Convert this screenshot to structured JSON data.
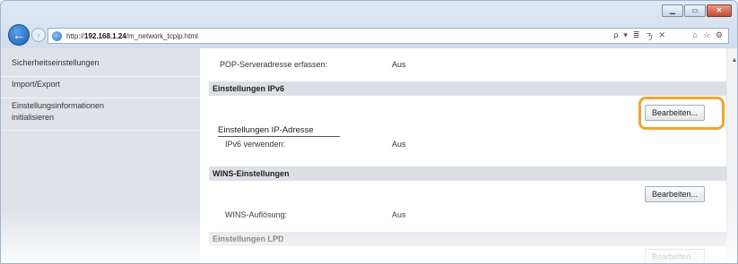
{
  "browser": {
    "url_prefix": "http://",
    "url_host": "192.168.1.24",
    "url_path": "/m_network_tcpip.html",
    "back_glyph": "←",
    "forward_glyph": "›",
    "address_tools": [
      "ρ",
      "▾",
      "≣",
      "ㄋ",
      "✕"
    ],
    "toolbar_icons": [
      "⌂",
      "☆",
      "⚙"
    ],
    "window_controls": [
      "▁",
      "▭",
      "✕"
    ]
  },
  "sidebar": {
    "items": [
      {
        "lines": [
          "Sicherheitseinstellungen"
        ]
      },
      {
        "lines": [
          "Import/Export"
        ]
      },
      {
        "lines": [
          "Einstellungsinformationen",
          "initialisieren"
        ]
      }
    ]
  },
  "main": {
    "pop_label": "POP-Serveradresse erfassen:",
    "pop_value": "Aus",
    "ipv6_section": "Einstellungen IPv6",
    "ipv6_edit_button": "Bearbeiten...",
    "ip_address_heading": "Einstellungen IP-Adresse",
    "ipv6_use_label": "IPv6 verwenden:",
    "ipv6_use_value": "Aus",
    "wins_section": "WINS-Einstellungen",
    "wins_edit_button": "Bearbeiten...",
    "wins_label": "WINS-Auflösung:",
    "wins_value": "Aus",
    "lpd_section": "Einstellungen LPD",
    "lpd_edit_button": "Bearbeiten..."
  },
  "colors": {
    "highlight": "#f0a531",
    "section_bg": "#dcdfe4",
    "sidebar_bg": "#dfe3e8"
  }
}
